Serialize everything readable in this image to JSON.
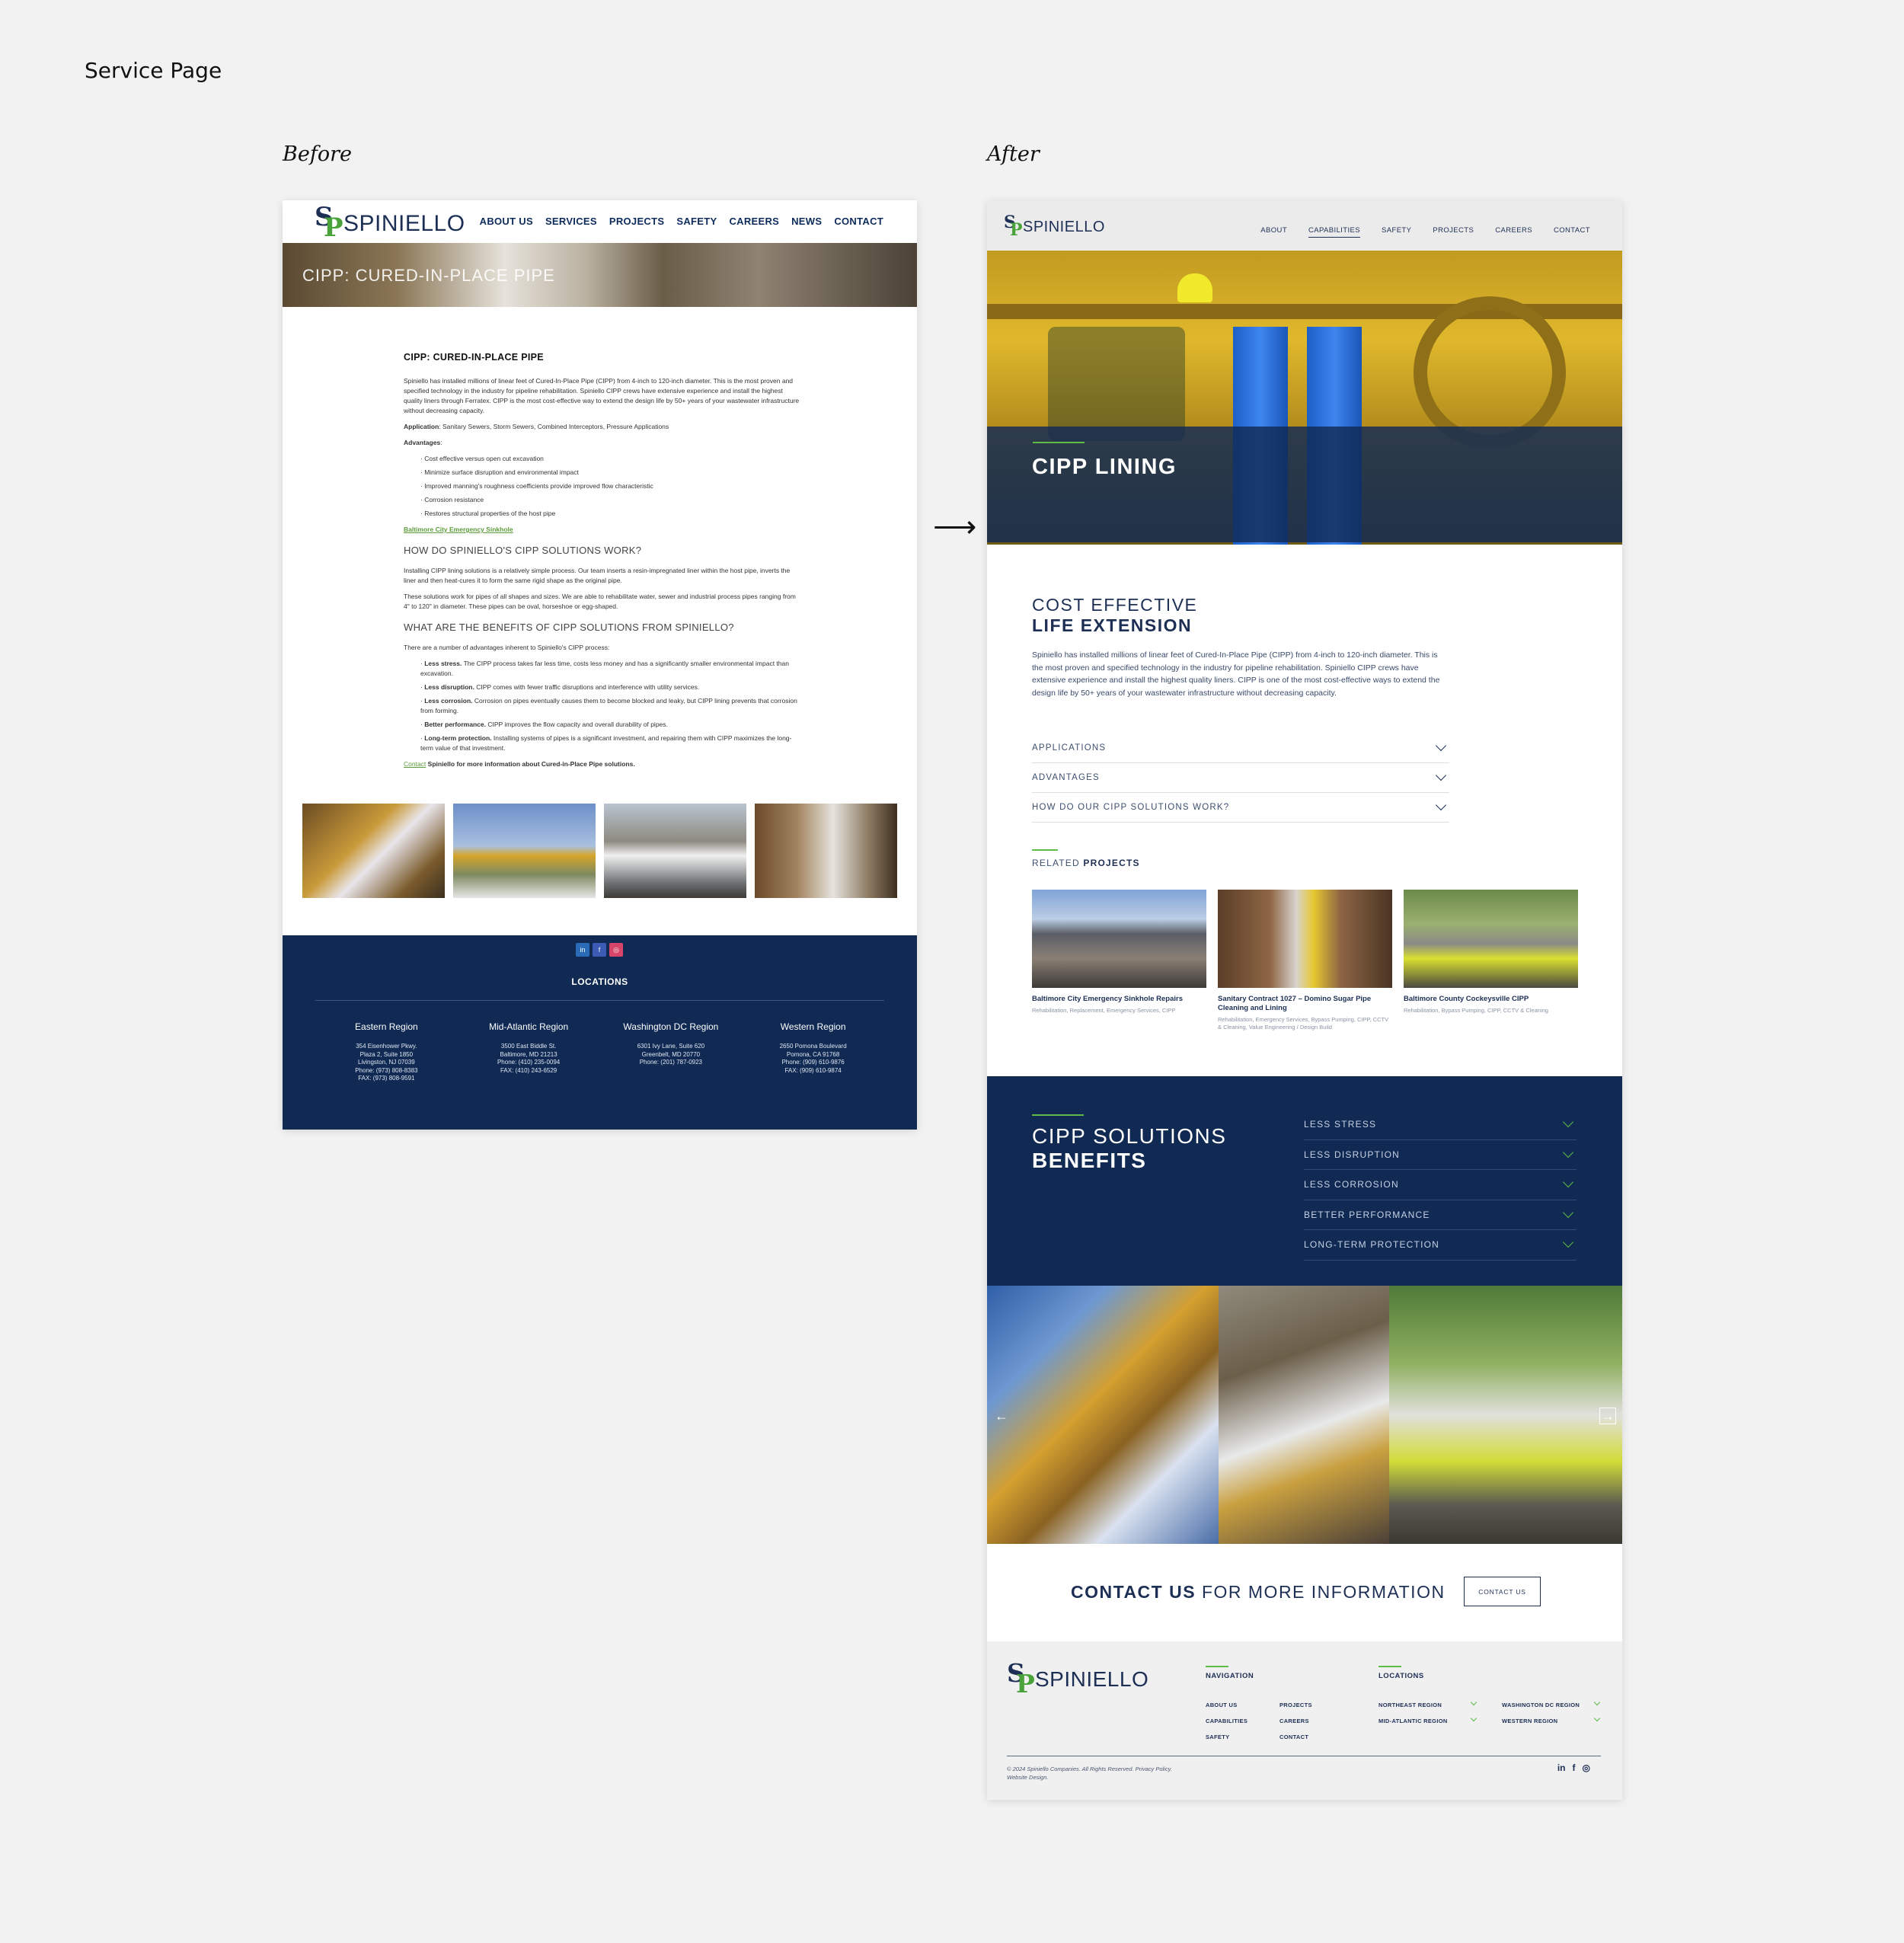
{
  "page_title": "Service Page",
  "labels": {
    "before": "Before",
    "after": "After",
    "arrow": "⟶"
  },
  "before": {
    "logo_text": "SPINIELLO",
    "nav": [
      "ABOUT US",
      "SERVICES",
      "PROJECTS",
      "SAFETY",
      "CAREERS",
      "NEWS",
      "CONTACT"
    ],
    "hero_title": "CIPP: CURED-IN-PLACE PIPE",
    "heading": "CIPP: CURED-IN-PLACE PIPE",
    "intro": "Spiniello has installed millions of linear feet of Cured-In-Place Pipe (CIPP) from 4-inch to 120-inch diameter. This is the most proven and specified technology in the industry for pipeline rehabilitation. Spiniello CIPP crews have extensive experience and install the highest quality liners through Ferratex. CIPP is the most cost-effective way to extend the design life by 50+ years of your wastewater infrastructure without decreasing capacity.",
    "application_label": "Application",
    "application_value": ": Sanitary Sewers, Storm Sewers, Combined Interceptors, Pressure Applications",
    "advantages_label": "Advantages",
    "advantages": [
      "Cost effective versus open cut excavation",
      "Minimize surface disruption and environmental impact",
      "Improved manning's roughness coefficients provide improved flow characteristic",
      "Corrosion resistance",
      "Restores structural properties of the host pipe"
    ],
    "link": "Baltimore City Emergency Sinkhole",
    "h2_how": "HOW DO SPINIELLO'S CIPP SOLUTIONS WORK?",
    "how_p1": "Installing CIPP lining solutions is a relatively simple process. Our team inserts a resin-impregnated liner within the host pipe, inverts the liner and then heat-cures it to form the same rigid shape as the original pipe.",
    "how_p2": "These solutions work for pipes of all shapes and sizes. We are able to rehabilitate water, sewer and industrial process pipes ranging from 4\" to 120\" in diameter. These pipes can be oval, horseshoe or egg-shaped.",
    "h2_benefits": "WHAT ARE THE BENEFITS OF CIPP SOLUTIONS FROM SPINIELLO?",
    "benefits_intro": "There are a number of advantages inherent to Spiniello's CIPP process:",
    "benefits": [
      {
        "label": "Less stress.",
        "text": " The CIPP process takes far less time, costs less money and has a significantly smaller environmental impact than excavation."
      },
      {
        "label": "Less disruption.",
        "text": " CIPP comes with fewer traffic disruptions and interference with utility services."
      },
      {
        "label": "Less corrosion.",
        "text": " Corrosion on pipes eventually causes them to become blocked and leaky, but CIPP lining prevents that corrosion from forming."
      },
      {
        "label": "Better performance.",
        "text": " CIPP improves the flow capacity and overall durability of pipes."
      },
      {
        "label": "Long-term protection.",
        "text": " Installing systems of pipes is a significant investment, and repairing them with CIPP maximizes the long-term value of that investment."
      }
    ],
    "contact_link": "Contact",
    "contact_text": " Spiniello for more information about Cured-in-Place Pipe solutions.",
    "social": [
      "in",
      "f",
      "◎"
    ],
    "locations_title": "LOCATIONS",
    "regions": [
      {
        "name": "Eastern Region",
        "address": "354 Eisenhower Pkwy.\nPlaza 2, Suite 1850\nLivingston, NJ 07039\nPhone: (973) 808-8383\nFAX: (973) 808-9591"
      },
      {
        "name": "Mid-Atlantic Region",
        "address": "3500 East Biddle St.\nBaltimore, MD 21213\nPhone: (410) 235-0094\nFAX: (410) 243-6529"
      },
      {
        "name": "Washington DC Region",
        "address": "6301 Ivy Lane, Suite 620\nGreenbelt, MD 20770\nPhone: (201) 787-0923"
      },
      {
        "name": "Western Region",
        "address": "2650 Pomona Boulevard\nPomona, CA 91768\nPhone: (909) 610-9876\nFAX: (909) 610-9874"
      }
    ]
  },
  "after": {
    "logo_text": "SPINIELLO",
    "nav": [
      {
        "label": "ABOUT",
        "active": false
      },
      {
        "label": "CAPABILITIES",
        "active": true
      },
      {
        "label": "SAFETY",
        "active": false
      },
      {
        "label": "PROJECTS",
        "active": false
      },
      {
        "label": "CAREERS",
        "active": false
      },
      {
        "label": "CONTACT",
        "active": false
      }
    ],
    "hero_title": "CIPP LINING",
    "intro_line1": "COST EFFECTIVE",
    "intro_line2": "LIFE EXTENSION",
    "intro_text": "Spiniello has installed millions of linear feet of Cured-In-Place Pipe (CIPP) from 4-inch to 120-inch diameter. This is the most proven and specified technology in the industry for pipeline rehabilitation. Spiniello CIPP crews have extensive experience and install the highest quality liners. CIPP is one of the most cost-effective ways to extend the design life by 50+ years of your wastewater infrastructure without decreasing capacity.",
    "accordion": [
      "APPLICATIONS",
      "ADVANTAGES",
      "HOW DO OUR CIPP SOLUTIONS WORK?"
    ],
    "related_prefix": "RELATED ",
    "related_bold": "PROJECTS",
    "projects": [
      {
        "name": "Baltimore City Emergency Sinkhole Repairs",
        "tags": "Rehabilitation, Replacement, Emergency Services, CIPP"
      },
      {
        "name": "Sanitary Contract 1027 – Domino Sugar Pipe Cleaning and Lining",
        "tags": "Rehabilitation, Emergency Services, Bypass Pumping, CIPP, CCTV & Cleaning, Value Engineering / Design Build"
      },
      {
        "name": "Baltimore County Cockeysville CIPP",
        "tags": "Rehabilitation, Bypass Pumping, CIPP, CCTV & Cleaning"
      }
    ],
    "benefits_line1": "CIPP SOLUTIONS",
    "benefits_line2": "BENEFITS",
    "benefits": [
      "LESS STRESS",
      "LESS DISRUPTION",
      "LESS CORROSION",
      "BETTER PERFORMANCE",
      "LONG-TERM PROTECTION"
    ],
    "gallery_prev": "←",
    "gallery_next": "→",
    "cta_bold": "CONTACT US",
    "cta_rest": " FOR MORE INFORMATION",
    "cta_button": "CONTACT US",
    "footer": {
      "navigation_title": "NAVIGATION",
      "nav_col1": [
        "ABOUT US",
        "CAPABILITIES",
        "SAFETY"
      ],
      "nav_col2": [
        "PROJECTS",
        "CAREERS",
        "CONTACT"
      ],
      "locations_title": "LOCATIONS",
      "loc_col1": [
        "NORTHEAST REGION",
        "MID-ATLANTIC REGION"
      ],
      "loc_col2": [
        "WASHINGTON DC REGION",
        "WESTERN REGION"
      ],
      "copyright_line1": "© 2024 Spiniello Companies. All Rights Reserved. Privacy Policy.",
      "copyright_line2": "Website Design.",
      "social": [
        "in",
        "f",
        "◎"
      ]
    }
  },
  "colors": {
    "navy": "#102a54",
    "accent_green": "#5dbb46",
    "brand_blue": "#1d2f55"
  }
}
